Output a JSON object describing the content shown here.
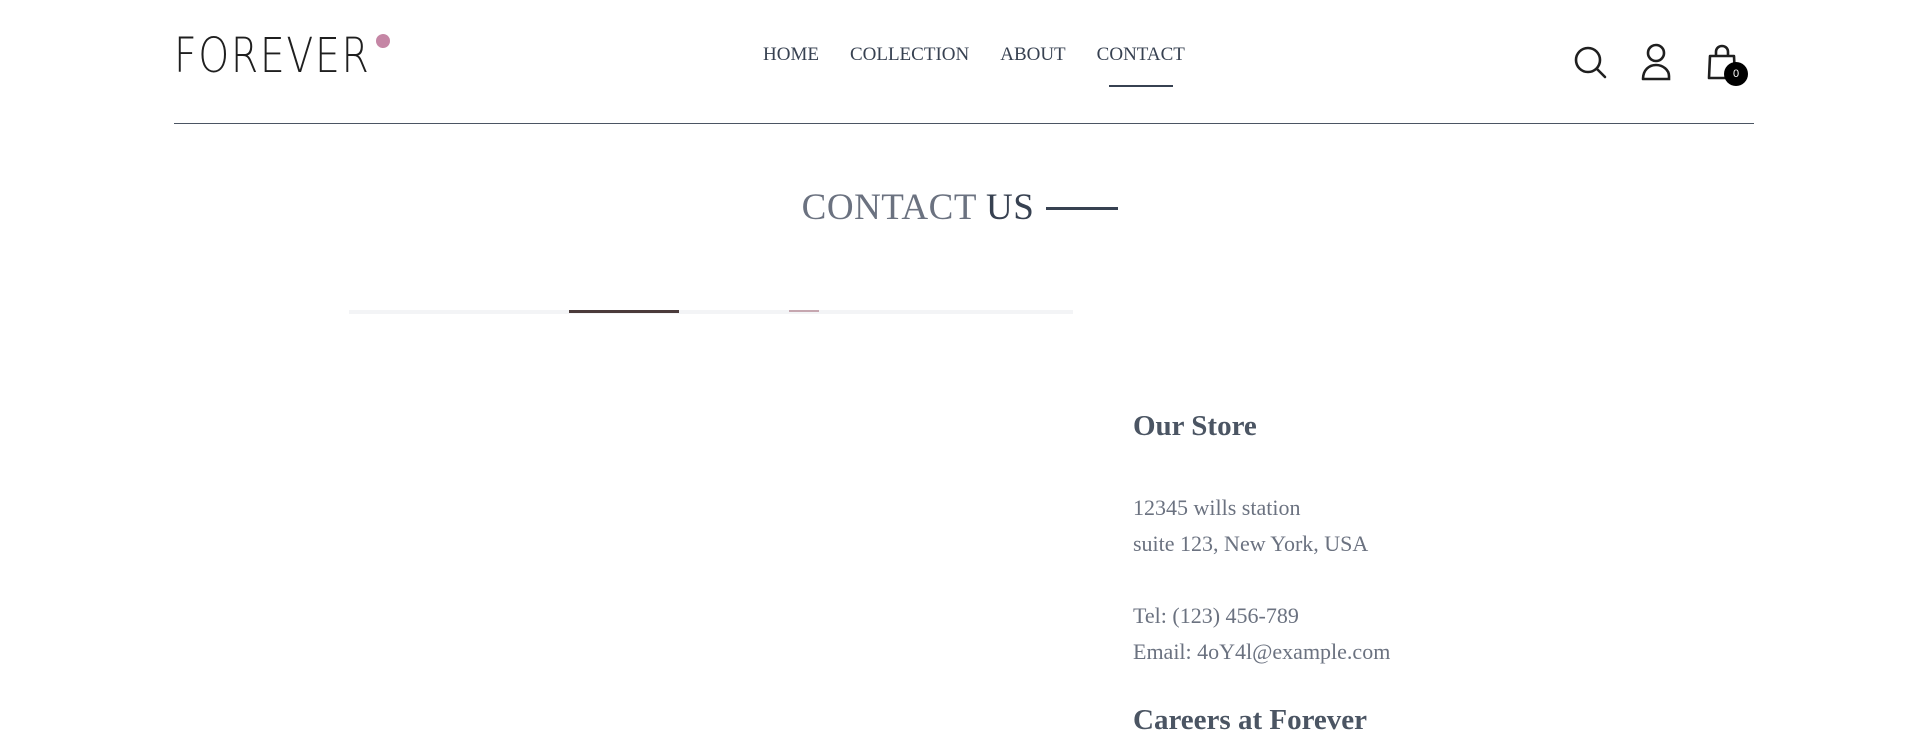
{
  "brand": {
    "logo_text": "FOREVER",
    "dot_color": "#c586a5"
  },
  "nav": {
    "items": [
      {
        "label": "HOME",
        "active": false
      },
      {
        "label": "COLLECTION",
        "active": false
      },
      {
        "label": "ABOUT",
        "active": false
      },
      {
        "label": "CONTACT",
        "active": true
      }
    ]
  },
  "header_icons": {
    "search": "search-icon",
    "profile": "profile-icon",
    "cart": "cart-icon",
    "cart_count": "0"
  },
  "page": {
    "title_part1": "CONTACT",
    "title_part2": "US"
  },
  "store": {
    "heading": "Our Store",
    "address_line1": "12345 wills station",
    "address_line2": "suite 123, New York, USA",
    "tel": "Tel: (123) 456-789",
    "email": "Email: 4oY4l@example.com"
  },
  "careers": {
    "heading": "Careers at Forever"
  },
  "colors": {
    "text_dark": "#374151",
    "text_muted": "#6b7280",
    "badge_bg": "#000000"
  }
}
